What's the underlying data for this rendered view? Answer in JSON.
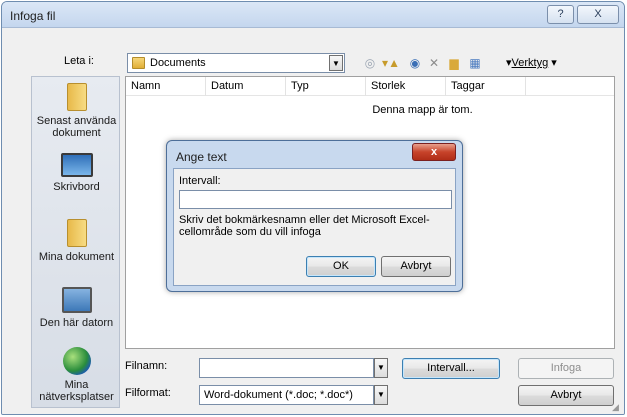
{
  "window": {
    "title": "Infoga fil",
    "help_glyph": "?",
    "close_glyph": "X"
  },
  "toolbar": {
    "lookin_label": "Leta i:",
    "lookin_value": "Documents",
    "tools_label": "Verktyg",
    "icons": [
      "back-icon",
      "up-folder-icon",
      "search-web-icon",
      "delete-icon",
      "new-folder-icon",
      "views-icon"
    ]
  },
  "places": [
    {
      "label": "Senast använda dokument",
      "icon": "recent-folder-icon"
    },
    {
      "label": "Skrivbord",
      "icon": "desktop-icon"
    },
    {
      "label": "Mina dokument",
      "icon": "documents-folder-icon"
    },
    {
      "label": "Den här datorn",
      "icon": "computer-icon"
    },
    {
      "label": "Mina nätverksplatser",
      "icon": "network-icon"
    }
  ],
  "filelist": {
    "columns": [
      "Namn",
      "Datum",
      "Typ",
      "Storlek",
      "Taggar"
    ],
    "empty_message": "Denna mapp är tom."
  },
  "footer": {
    "filename_label": "Filnamn:",
    "filename_value": "",
    "format_label": "Filformat:",
    "format_value": "Word-dokument (*.doc; *.doc*)",
    "range_button": "Intervall...",
    "insert_button": "Infoga",
    "cancel_button": "Avbryt"
  },
  "modal": {
    "title": "Ange text",
    "close_glyph": "x",
    "field_label": "Intervall:",
    "field_value": "",
    "help_text": "Skriv det bokmärkesnamn eller det Microsoft Excel-cellområde som du vill infoga",
    "ok_button": "OK",
    "cancel_button": "Avbryt"
  }
}
